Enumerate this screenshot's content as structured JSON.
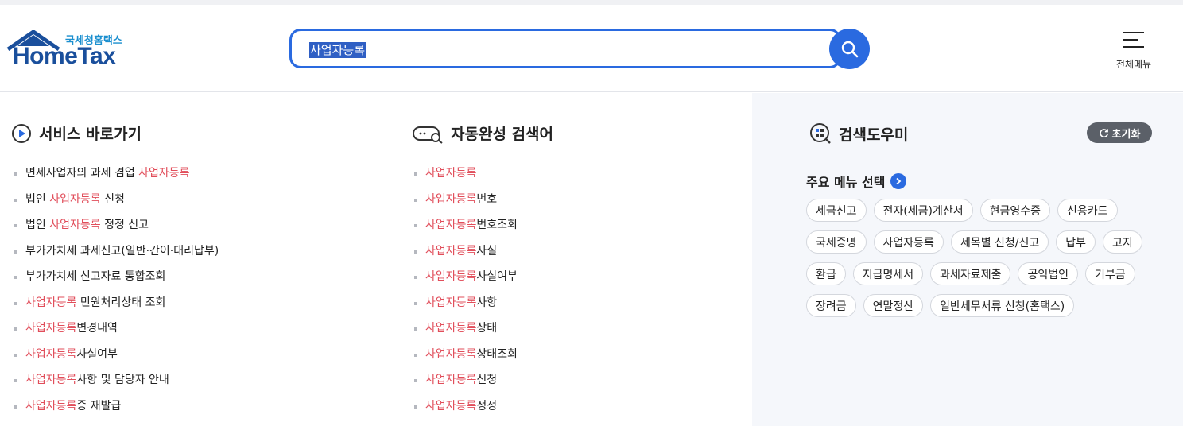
{
  "header": {
    "logo_sub": "국세청홈택스",
    "logo_main": "HomeTax",
    "search_value": "사업자등록",
    "search_button_icon": "search-icon",
    "menu_label": "전체메뉴",
    "menu_icon": "hamburger-icon"
  },
  "colors": {
    "accent": "#2a6ae0",
    "highlight": "#e14d5a",
    "logo_blue": "#1a4f9c"
  },
  "service": {
    "title": "서비스 바로가기",
    "icon": "play-circle-icon",
    "items": [
      {
        "pre": "면세사업자의 과세 겸업 ",
        "hl": "사업자등록",
        "post": ""
      },
      {
        "pre": "법인 ",
        "hl": "사업자등록",
        "post": " 신청"
      },
      {
        "pre": "법인 ",
        "hl": "사업자등록",
        "post": " 정정 신고"
      },
      {
        "pre": "부가가치세 과세신고(일반·간이·대리납부)",
        "hl": "",
        "post": ""
      },
      {
        "pre": "부가가치세 신고자료 통합조회",
        "hl": "",
        "post": ""
      },
      {
        "pre": "",
        "hl": "사업자등록",
        "post": " 민원처리상태 조회"
      },
      {
        "pre": "",
        "hl": "사업자등록",
        "post": "변경내역"
      },
      {
        "pre": "",
        "hl": "사업자등록",
        "post": "사실여부"
      },
      {
        "pre": "",
        "hl": "사업자등록",
        "post": "사항 및 담당자 안내"
      },
      {
        "pre": "",
        "hl": "사업자등록",
        "post": "증 재발급"
      }
    ]
  },
  "autocomplete": {
    "title": "자동완성 검색어",
    "icon": "chat-search-icon",
    "items": [
      {
        "hl": "사업자등록",
        "post": ""
      },
      {
        "hl": "사업자등록",
        "post": "번호"
      },
      {
        "hl": "사업자등록",
        "post": "번호조회"
      },
      {
        "hl": "사업자등록",
        "post": "사실"
      },
      {
        "hl": "사업자등록",
        "post": "사실여부"
      },
      {
        "hl": "사업자등록",
        "post": "사항"
      },
      {
        "hl": "사업자등록",
        "post": "상태"
      },
      {
        "hl": "사업자등록",
        "post": "상태조회"
      },
      {
        "hl": "사업자등록",
        "post": "신청"
      },
      {
        "hl": "사업자등록",
        "post": "정정"
      }
    ]
  },
  "helper": {
    "title": "검색도우미",
    "icon": "grid-search-icon",
    "reset_label": "초기화",
    "reset_icon": "refresh-icon",
    "menu_select_title": "주요 메뉴 선택",
    "menu_select_icon": "chevron-right-icon",
    "chip_rows": [
      [
        "세금신고",
        "전자(세금)계산서",
        "현금영수증",
        "신용카드"
      ],
      [
        "국세증명",
        "사업자등록",
        "세목별 신청/신고",
        "납부",
        "고지"
      ],
      [
        "환급",
        "지급명세서",
        "과세자료제출",
        "공익법인",
        "기부금"
      ],
      [
        "장려금",
        "연말정산",
        "일반세무서류 신청(홈택스)"
      ]
    ]
  }
}
